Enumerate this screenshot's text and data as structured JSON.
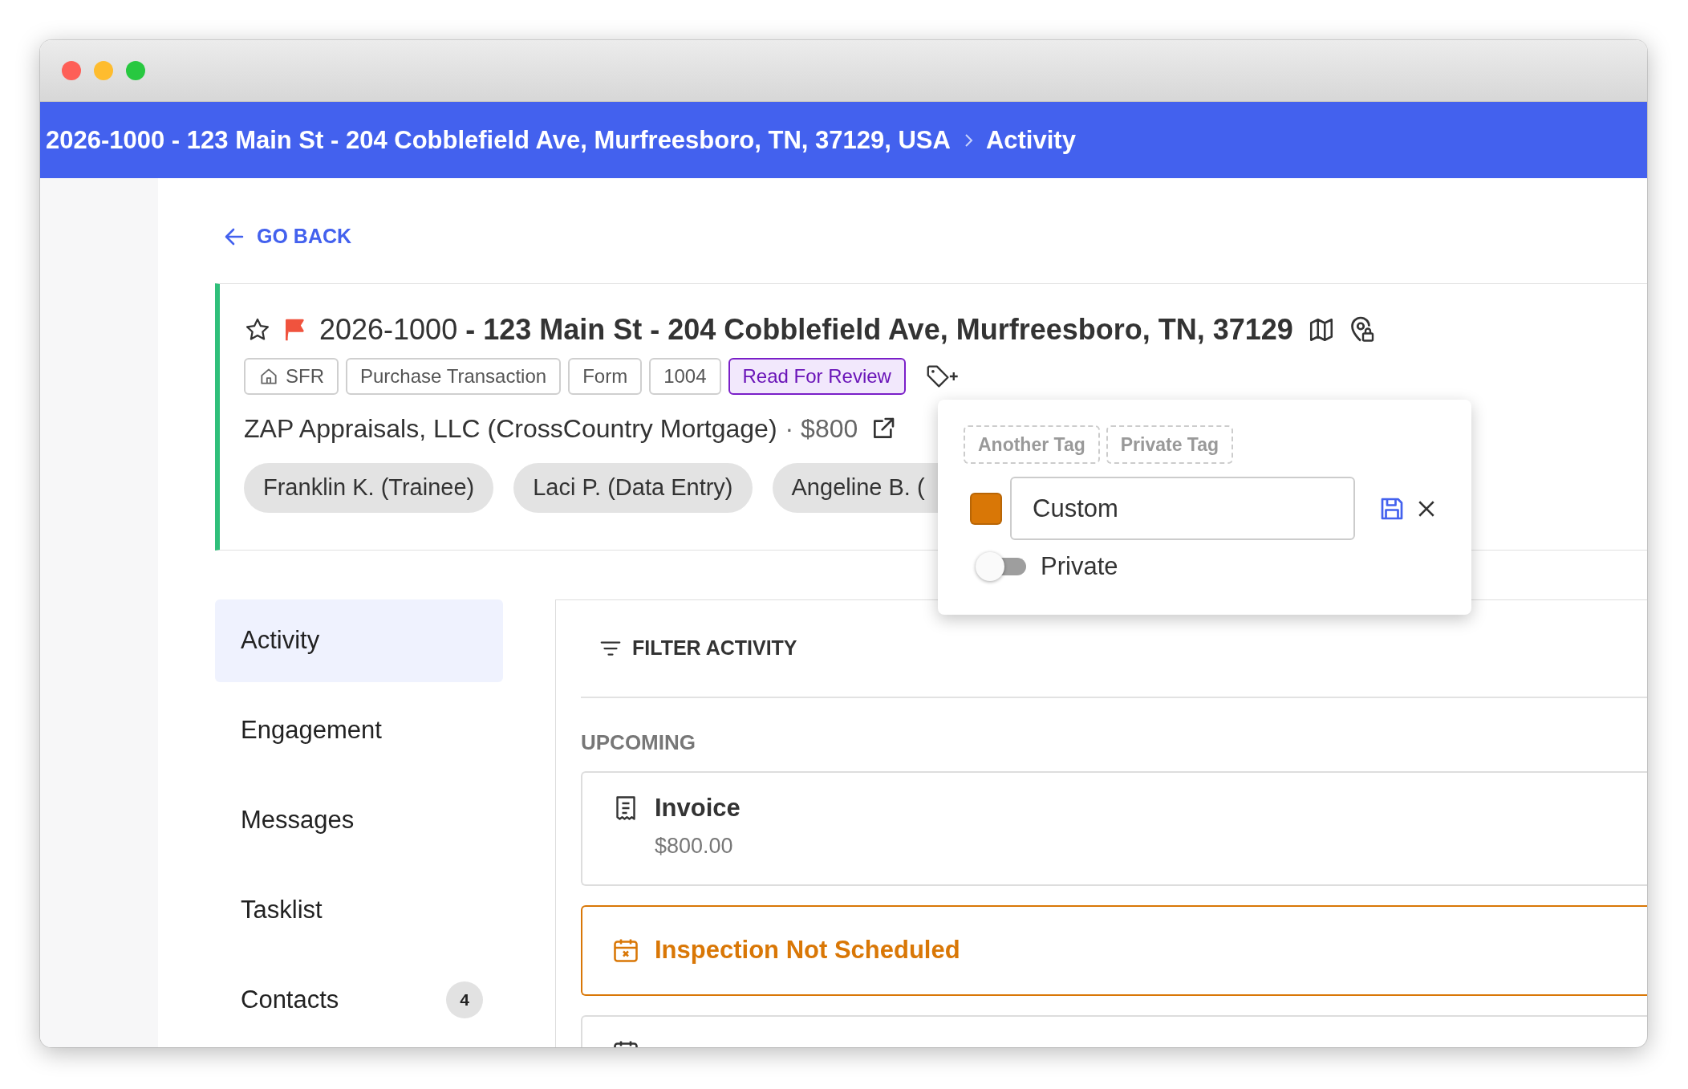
{
  "breadcrumb": [
    {
      "label": "2026-1000 - 123 Main St - 204 Cobblefield Ave, Murfreesboro, TN, 37129, USA"
    },
    {
      "label": "Activity"
    }
  ],
  "back_link": "GO BACK",
  "order": {
    "starred": false,
    "flagged": true,
    "title": "2026-1000 **- 123 Main St - 204 Cobblefield Ave, Murfreesboro, TN, 37129**",
    "tags": [
      {
        "label": "SFR",
        "kind": "home"
      },
      {
        "label": "Purchase Transaction",
        "kind": "plain"
      },
      {
        "label": "Form",
        "kind": "plain"
      },
      {
        "label": "1004",
        "kind": "plain"
      },
      {
        "label": "Read For Review",
        "kind": "status"
      }
    ],
    "company": "ZAP Appraisals, LLC (CrossCountry Mortgage)",
    "fee": "· $800",
    "assignees": [
      "Franklin K. (Trainee)",
      "Laci P. (Data Entry)",
      "Angeline B. ("
    ]
  },
  "tag_popover": {
    "suggestions": [
      "Another Tag",
      "Private Tag"
    ],
    "color": "#d97706",
    "value": "Custom",
    "private": false,
    "private_label": "Private"
  },
  "nav": [
    {
      "label": "Activity",
      "selected": true
    },
    {
      "label": "Engagement",
      "selected": false
    },
    {
      "label": "Messages",
      "selected": false
    },
    {
      "label": "Tasklist",
      "selected": false
    },
    {
      "label": "Contacts",
      "selected": false,
      "count": "4"
    }
  ],
  "activity": {
    "filter_label": "FILTER ACTIVITY",
    "section": "UPCOMING",
    "items": [
      {
        "kind": "invoice",
        "title": "Invoice",
        "subtitle": "$800.00"
      },
      {
        "kind": "alert",
        "title": "Inspection Not Scheduled"
      },
      {
        "kind": "event"
      }
    ]
  }
}
